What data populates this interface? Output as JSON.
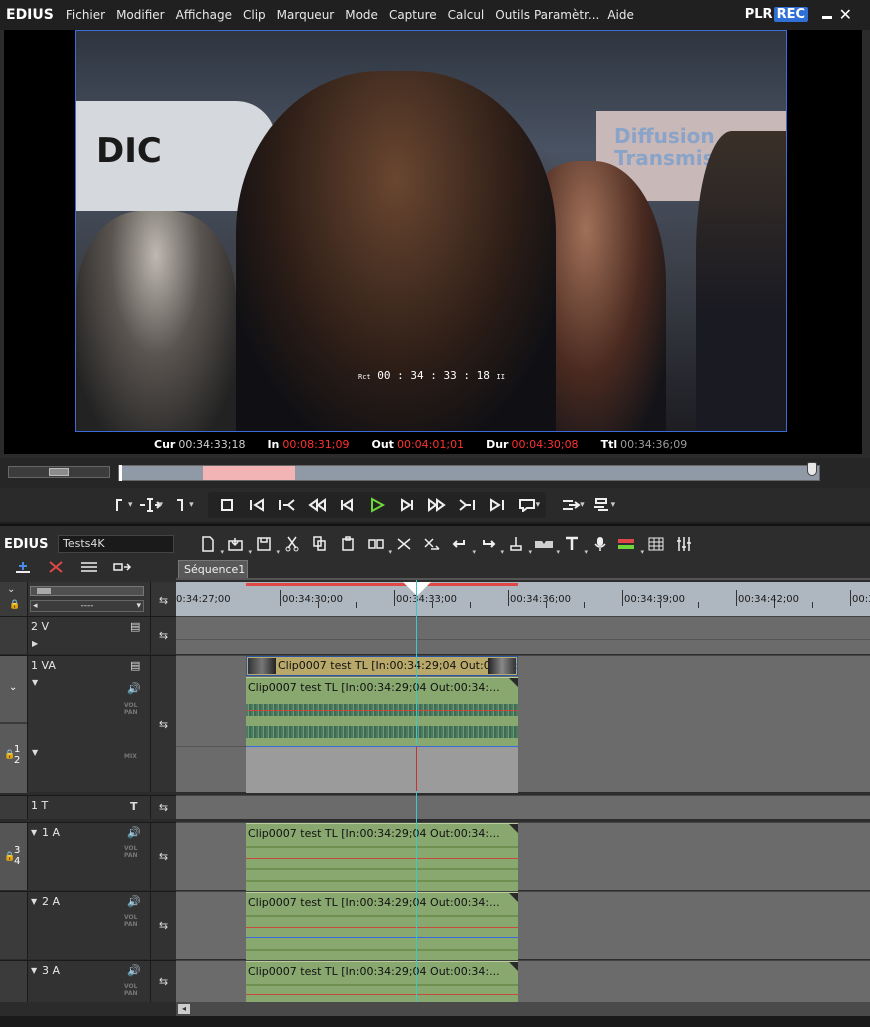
{
  "player": {
    "app_title": "EDIUS",
    "menu": [
      "Fichier",
      "Modifier",
      "Affichage",
      "Clip",
      "Marqueur",
      "Mode",
      "Capture",
      "Calcul",
      "Outils",
      "Paramètr...",
      "Aide"
    ],
    "plr_label": "PLR",
    "rec_label": "REC",
    "close_glyph": "✕",
    "video": {
      "banner_text_1": "Diffusion",
      "banner_text_2": "Transmis",
      "kiosk_text": "DIC",
      "overlay_rct": "Rct",
      "overlay_tc": "00 : 34 : 33 : 18",
      "overlay_suffix": "II"
    },
    "timecodes": {
      "cur_label": "Cur",
      "cur_value": "00:34:33;18",
      "in_label": "In",
      "in_value": "00:08:31;09",
      "out_label": "Out",
      "out_value": "00:04:01;01",
      "dur_label": "Dur",
      "dur_value": "00:04:30;08",
      "ttl_label": "Ttl",
      "ttl_value": "00:34:36;09"
    },
    "transport_icons": [
      "set-in-icon",
      "set-out-icon",
      "stop-icon",
      "prev-edit-icon",
      "rewind-icon",
      "step-back-icon",
      "play-icon",
      "step-forward-icon",
      "fast-forward-icon",
      "next-edit-icon",
      "loop-icon",
      "overwrite-icon"
    ]
  },
  "timeline": {
    "app_title": "EDIUS",
    "project_name": "Tests4K",
    "sequence_tab": "Séquence1",
    "ruler_labels": [
      "0:34:27;00",
      "00:34:30;00",
      "00:34:33;00",
      "00:34:36;00",
      "00:34:39;00",
      "00:34:42;00",
      "00:3"
    ],
    "zoom_value": "----",
    "tracks": {
      "v2": {
        "name": "2 V"
      },
      "va1": {
        "name": "1 VA",
        "video_clip": "Clip0007 test  TL [In:00:34:29;04 Out:00:34:...",
        "audio_clip": "Clip0007 test  TL [In:00:34:29;04 Out:00:34:...",
        "a_number_top": "1",
        "a_number_bottom": "2",
        "vol_label": "VOL",
        "pan_label": "PAN",
        "mix_label": "MIX"
      },
      "t1": {
        "name": "1 T"
      },
      "a1": {
        "name": "1 A",
        "clip": "Clip0007 test  TL [In:00:34:29;04 Out:00:34:...",
        "a_number_top": "3",
        "a_number_bottom": "4"
      },
      "a2": {
        "name": "2 A",
        "clip": "Clip0007 test  TL [In:00:34:29;04 Out:00:34:..."
      },
      "a3": {
        "name": "3 A",
        "clip": "Clip0007 test  TL [In:00:34:29;04 Out:00:34:..."
      }
    }
  },
  "colors": {
    "accent_blue": "#2f6fd6",
    "play_green": "#6fd63a",
    "timecode_red": "#ff3030",
    "video_clip": "#b8a86a",
    "audio_clip": "#89a870",
    "playline": "#3cc8c8"
  }
}
